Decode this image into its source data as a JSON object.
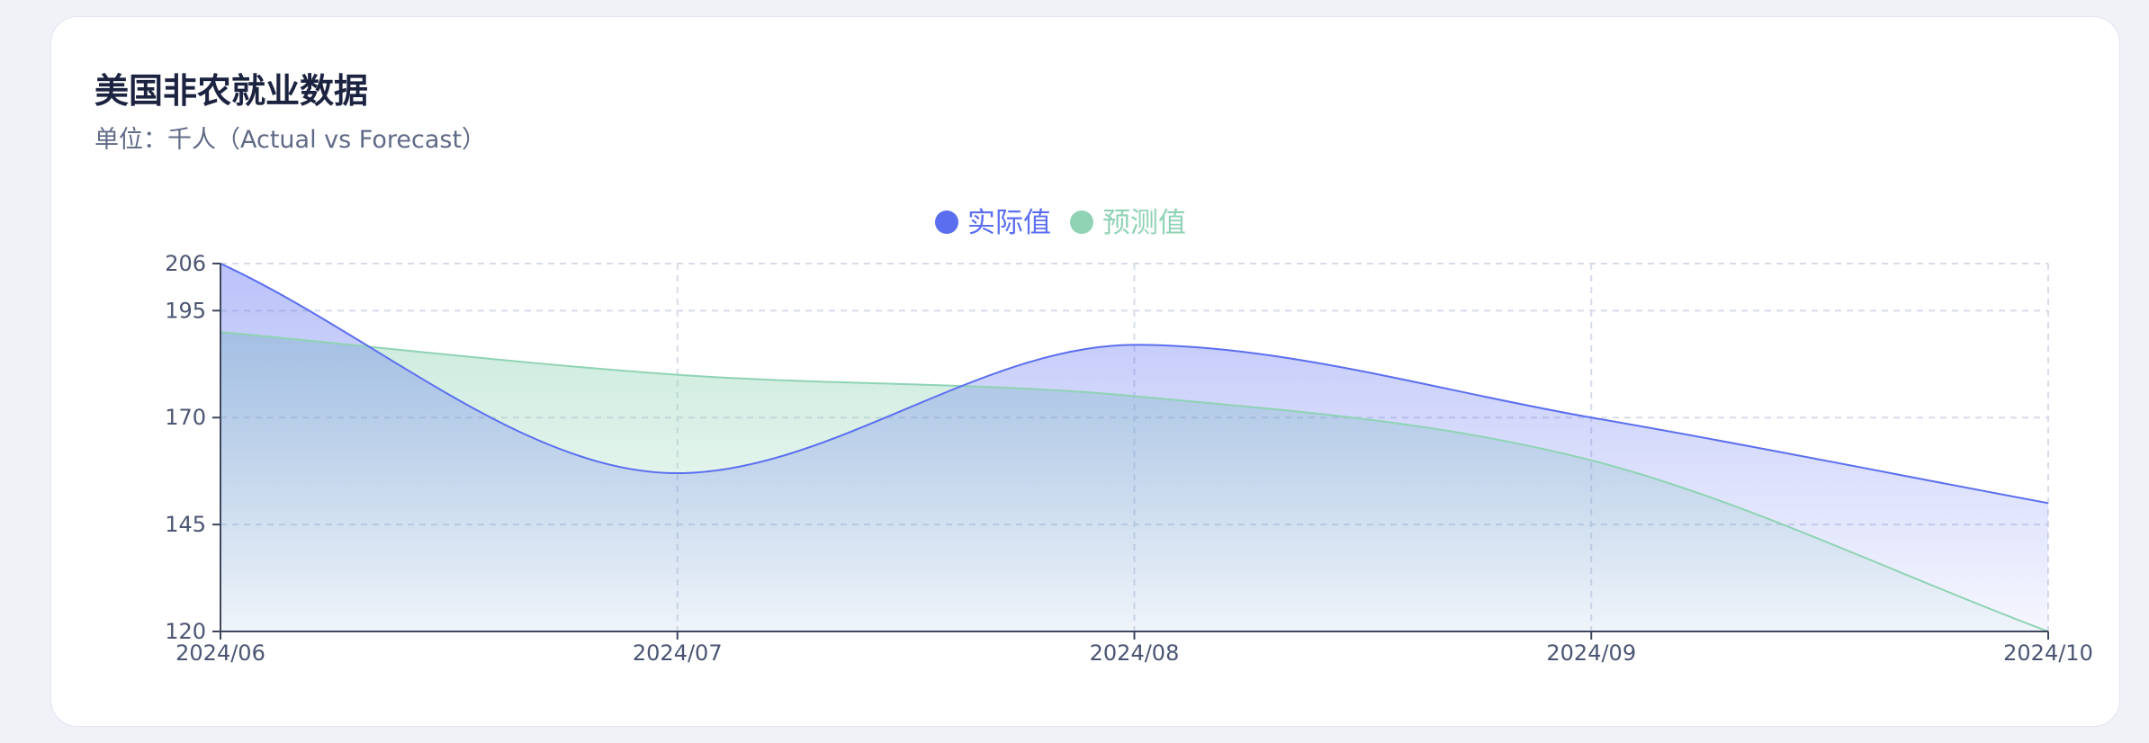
{
  "card": {
    "title": "美国非农就业数据",
    "subtitle": "单位：千人（Actual vs Forecast）"
  },
  "colors": {
    "actual": "#5b6ef0",
    "forecast": "#8fd3b4",
    "grid": "#d7dcea",
    "axis": "#3f475e"
  },
  "chart_data": {
    "type": "area",
    "categories": [
      "2024/06",
      "2024/07",
      "2024/08",
      "2024/09",
      "2024/10"
    ],
    "series": [
      {
        "name": "实际值",
        "values": [
          206,
          157,
          187,
          170,
          150
        ]
      },
      {
        "name": "预测值",
        "values": [
          190,
          180,
          175,
          160,
          120
        ]
      }
    ],
    "ylim": [
      120,
      206
    ],
    "yticks": [
      120,
      145,
      170,
      195,
      206
    ],
    "grid": true,
    "legend_position": "top-center",
    "smooth": true
  }
}
